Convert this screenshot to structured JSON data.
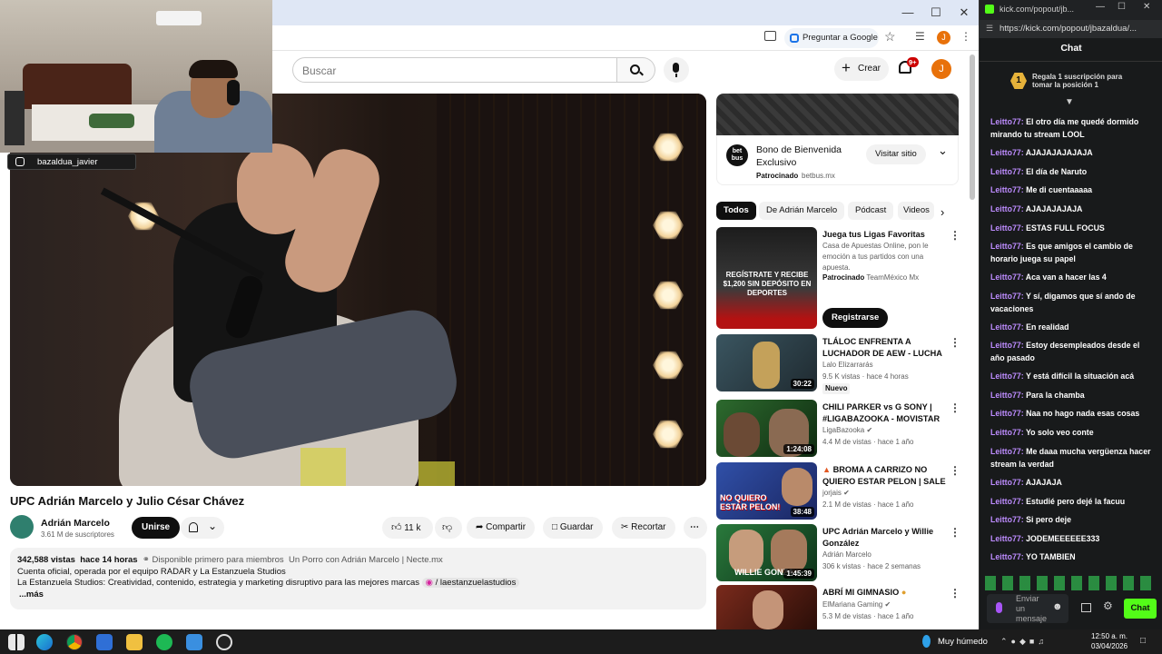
{
  "browser": {
    "ask_google": "Preguntar a Google",
    "avatar_letter": "J"
  },
  "youtube": {
    "search_placeholder": "Buscar",
    "create_label": "Crear",
    "notif_badge": "9+",
    "avatar_letter": "J",
    "video_title": "UPC Adrián Marcelo y Julio César Chávez",
    "channel_name": "Adrián Marcelo",
    "subscribers": "3.61 M de suscriptores",
    "join_label": "Unirse",
    "likes": "11 k",
    "share_label": "Compartir",
    "save_label": "Guardar",
    "clip_label": "Recortar",
    "desc_views": "342,588 vistas",
    "desc_time": "hace 14 horas",
    "desc_members": "Disponible primero para miembros",
    "desc_series": "Un Porro con Adrián Marcelo | Necte.mx",
    "desc_line2": "Cuenta oficial, operada por el equipo RADAR y La Estanzuela Studios",
    "desc_line3": "La Estanzuela Studios: Creatividad, contenido, estrategia y marketing disruptivo para las mejores marcas",
    "desc_ig": "/ laestanzuelastudios",
    "desc_more": "...más",
    "ad": {
      "logo_text": "bet bus",
      "title": "Bono de Bienvenida Exclusivo",
      "sponsored": "Patrocinado",
      "domain": "betbus.mx",
      "cta": "Visitar sitio"
    },
    "chips": [
      "Todos",
      "De Adrián Marcelo",
      "Pódcast",
      "Videos"
    ],
    "promo": {
      "title": "Juega tus Ligas Favoritas",
      "desc": "Casa de Apuestas Online, pon le emoción a tus partidos con una apuesta.",
      "sponsored": "Patrocinado",
      "advertiser": "TeamMéxico Mx",
      "cta": "Registrarse",
      "thumb_text": "REGÍSTRATE Y RECIBE $1,200 SIN DEPÓSITO EN DEPORTES"
    },
    "videos": [
      {
        "title": "TLÁLOC ENFRENTA A LUCHADOR DE AEW - LUCHA ...",
        "channel": "Lalo Elizarrarás",
        "meta": "9.5 K vistas · hace 4 horas",
        "badge": "Nuevo",
        "duration": "30:22"
      },
      {
        "title": "CHILI PARKER vs G SONY | #LIGABAZOOKA - MOVISTAR ...",
        "channel": "LigaBazooka",
        "meta": "4.4 M de vistas · hace 1 año",
        "duration": "1:24:08"
      },
      {
        "title": "BROMA A CARRIZO NO QUIERO ESTAR PELON | SALE ...",
        "channel": "jorjais",
        "meta": "2.1 M de vistas · hace 1 año",
        "duration": "38:48",
        "thumb_text": "NO QUIERO ESTAR PELON!"
      },
      {
        "title": "UPC Adrián Marcelo y Willie González",
        "channel": "Adrián Marcelo",
        "meta": "306 k vistas · hace 2 semanas",
        "duration": "1:45:39",
        "thumb_text": "WILLIE GONZA"
      },
      {
        "title": "ABRÍ MI GIMNASIO",
        "channel": "ElMariana Gaming",
        "meta": "5.3 M de vistas · hace 1 año"
      }
    ]
  },
  "kick": {
    "url_short": "kick.com/popout/jb...",
    "url": "https://kick.com/popout/jbazaldua/...",
    "header": "Chat",
    "pinned_rank": "1",
    "pinned_text": "Regala 1 suscripción para tomar la posición 1",
    "messages": [
      {
        "user": "Leitto77:",
        "text": "El otro día me quedé dormido mirando tu stream LOOL"
      },
      {
        "user": "Leitto77:",
        "text": "AJAJAJAJAJAJA"
      },
      {
        "user": "Leitto77:",
        "text": "El día de Naruto"
      },
      {
        "user": "Leitto77:",
        "text": "Me di cuentaaaaa"
      },
      {
        "user": "Leitto77:",
        "text": "AJAJAJAJAJA"
      },
      {
        "user": "Leitto77:",
        "text": "ESTAS FULL FOCUS"
      },
      {
        "user": "Leitto77:",
        "text": "Es que amigos el cambio de horario juega su papel"
      },
      {
        "user": "Leitto77:",
        "text": "Aca van a hacer las 4"
      },
      {
        "user": "Leitto77:",
        "text": "Y sí, digamos que sí ando de vacaciones"
      },
      {
        "user": "Leitto77:",
        "text": "En realidad"
      },
      {
        "user": "Leitto77:",
        "text": "Estoy desempleados desde el año pasado"
      },
      {
        "user": "Leitto77:",
        "text": "Y está difícil la situación acá"
      },
      {
        "user": "Leitto77:",
        "text": "Para la chamba"
      },
      {
        "user": "Leitto77:",
        "text": "Naa no hago nada esas cosas"
      },
      {
        "user": "Leitto77:",
        "text": "Yo solo veo conte"
      },
      {
        "user": "Leitto77:",
        "text": "Me daaa mucha vergüenza hacer stream la verdad"
      },
      {
        "user": "Leitto77:",
        "text": "AJAJAJA"
      },
      {
        "user": "Leitto77:",
        "text": "Estudié pero dejé la facuu"
      },
      {
        "user": "Leitto77:",
        "text": "Si pero deje"
      },
      {
        "user": "Leitto77:",
        "text": "JODEMEEEEEE333"
      },
      {
        "user": "Leitto77:",
        "text": "YO TAMBIEN"
      }
    ],
    "input_placeholder": "Enviar un mensaje",
    "send_label": "Chat"
  },
  "overlay": {
    "handle": "bazaldua_javier"
  },
  "taskbar": {
    "weather": "Muy húmedo",
    "time": "12:50 a. m.",
    "date": "03/04/2026"
  },
  "colors": {
    "kick_green": "#53fc18",
    "kick_user": "#bd8cff",
    "yt_red": "#ff0000"
  }
}
